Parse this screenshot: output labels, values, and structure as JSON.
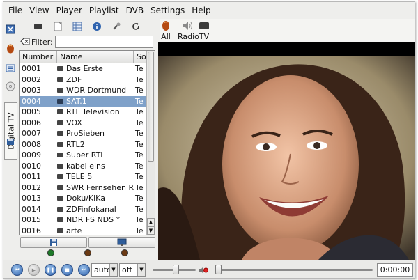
{
  "menubar": {
    "items": [
      "File",
      "View",
      "Player",
      "Playlist",
      "DVB",
      "Settings",
      "Help"
    ]
  },
  "sidebar_tabs": {
    "icons": [
      "media-icon",
      "disc-icon",
      "playlist-icon",
      "cd-icon",
      "save-icon"
    ],
    "active_tab_label": "Digital TV"
  },
  "channel_panel": {
    "toolbar_icons": [
      "tv-icon",
      "page-icon",
      "list-icon",
      "info-icon",
      "wrench-icon",
      "refresh-icon"
    ],
    "filter_label": "Filter:",
    "filter_value": "",
    "columns": [
      "Number",
      "Name",
      "So"
    ],
    "rows": [
      {
        "number": "0001",
        "name": "Das Erste",
        "src": "Te"
      },
      {
        "number": "0002",
        "name": "ZDF",
        "src": "Te"
      },
      {
        "number": "0003",
        "name": "WDR Dortmund",
        "src": "Te"
      },
      {
        "number": "0004",
        "name": "SAT.1",
        "src": "Te"
      },
      {
        "number": "0005",
        "name": "RTL Television",
        "src": "Te"
      },
      {
        "number": "0006",
        "name": "VOX",
        "src": "Te"
      },
      {
        "number": "0007",
        "name": "ProSieben",
        "src": "Te"
      },
      {
        "number": "0008",
        "name": "RTL2",
        "src": "Te"
      },
      {
        "number": "0009",
        "name": "Super RTL",
        "src": "Te"
      },
      {
        "number": "0010",
        "name": "kabel eins",
        "src": "Te"
      },
      {
        "number": "0011",
        "name": "TELE 5",
        "src": "Te"
      },
      {
        "number": "0012",
        "name": "SWR Fernsehen RP",
        "src": "Te"
      },
      {
        "number": "0013",
        "name": "Doku/KiKa",
        "src": "Te"
      },
      {
        "number": "0014",
        "name": "ZDFinfokanal",
        "src": "Te"
      },
      {
        "number": "0015",
        "name": "NDR FS NDS *",
        "src": "Te"
      },
      {
        "number": "0016",
        "name": "arte",
        "src": "Te"
      }
    ],
    "selected_row": "0004",
    "bottom_buttons": [
      "save-icon",
      "monitor-icon"
    ],
    "status_leds": [
      {
        "name": "signal-led",
        "color": "#1f7a2a"
      },
      {
        "name": "record-led",
        "color": "#6b3a14"
      },
      {
        "name": "epg-led",
        "color": "#6b3a14"
      }
    ]
  },
  "right_toolbar": {
    "items": [
      {
        "icon": "all-icon",
        "label": "All"
      },
      {
        "icon": "radio-icon",
        "label": "Radio"
      },
      {
        "icon": "tv-icon",
        "label": "TV"
      }
    ]
  },
  "controls": {
    "buttons": [
      "previous",
      "play",
      "pause",
      "stop",
      "next"
    ],
    "audio_channel": "auto",
    "subtitle": "off",
    "volume_level": 0.55,
    "position_level": 0.0,
    "time": "0:00:00"
  },
  "colors": {
    "selection": "#7fa1c9",
    "accent": "#2f63ae"
  }
}
